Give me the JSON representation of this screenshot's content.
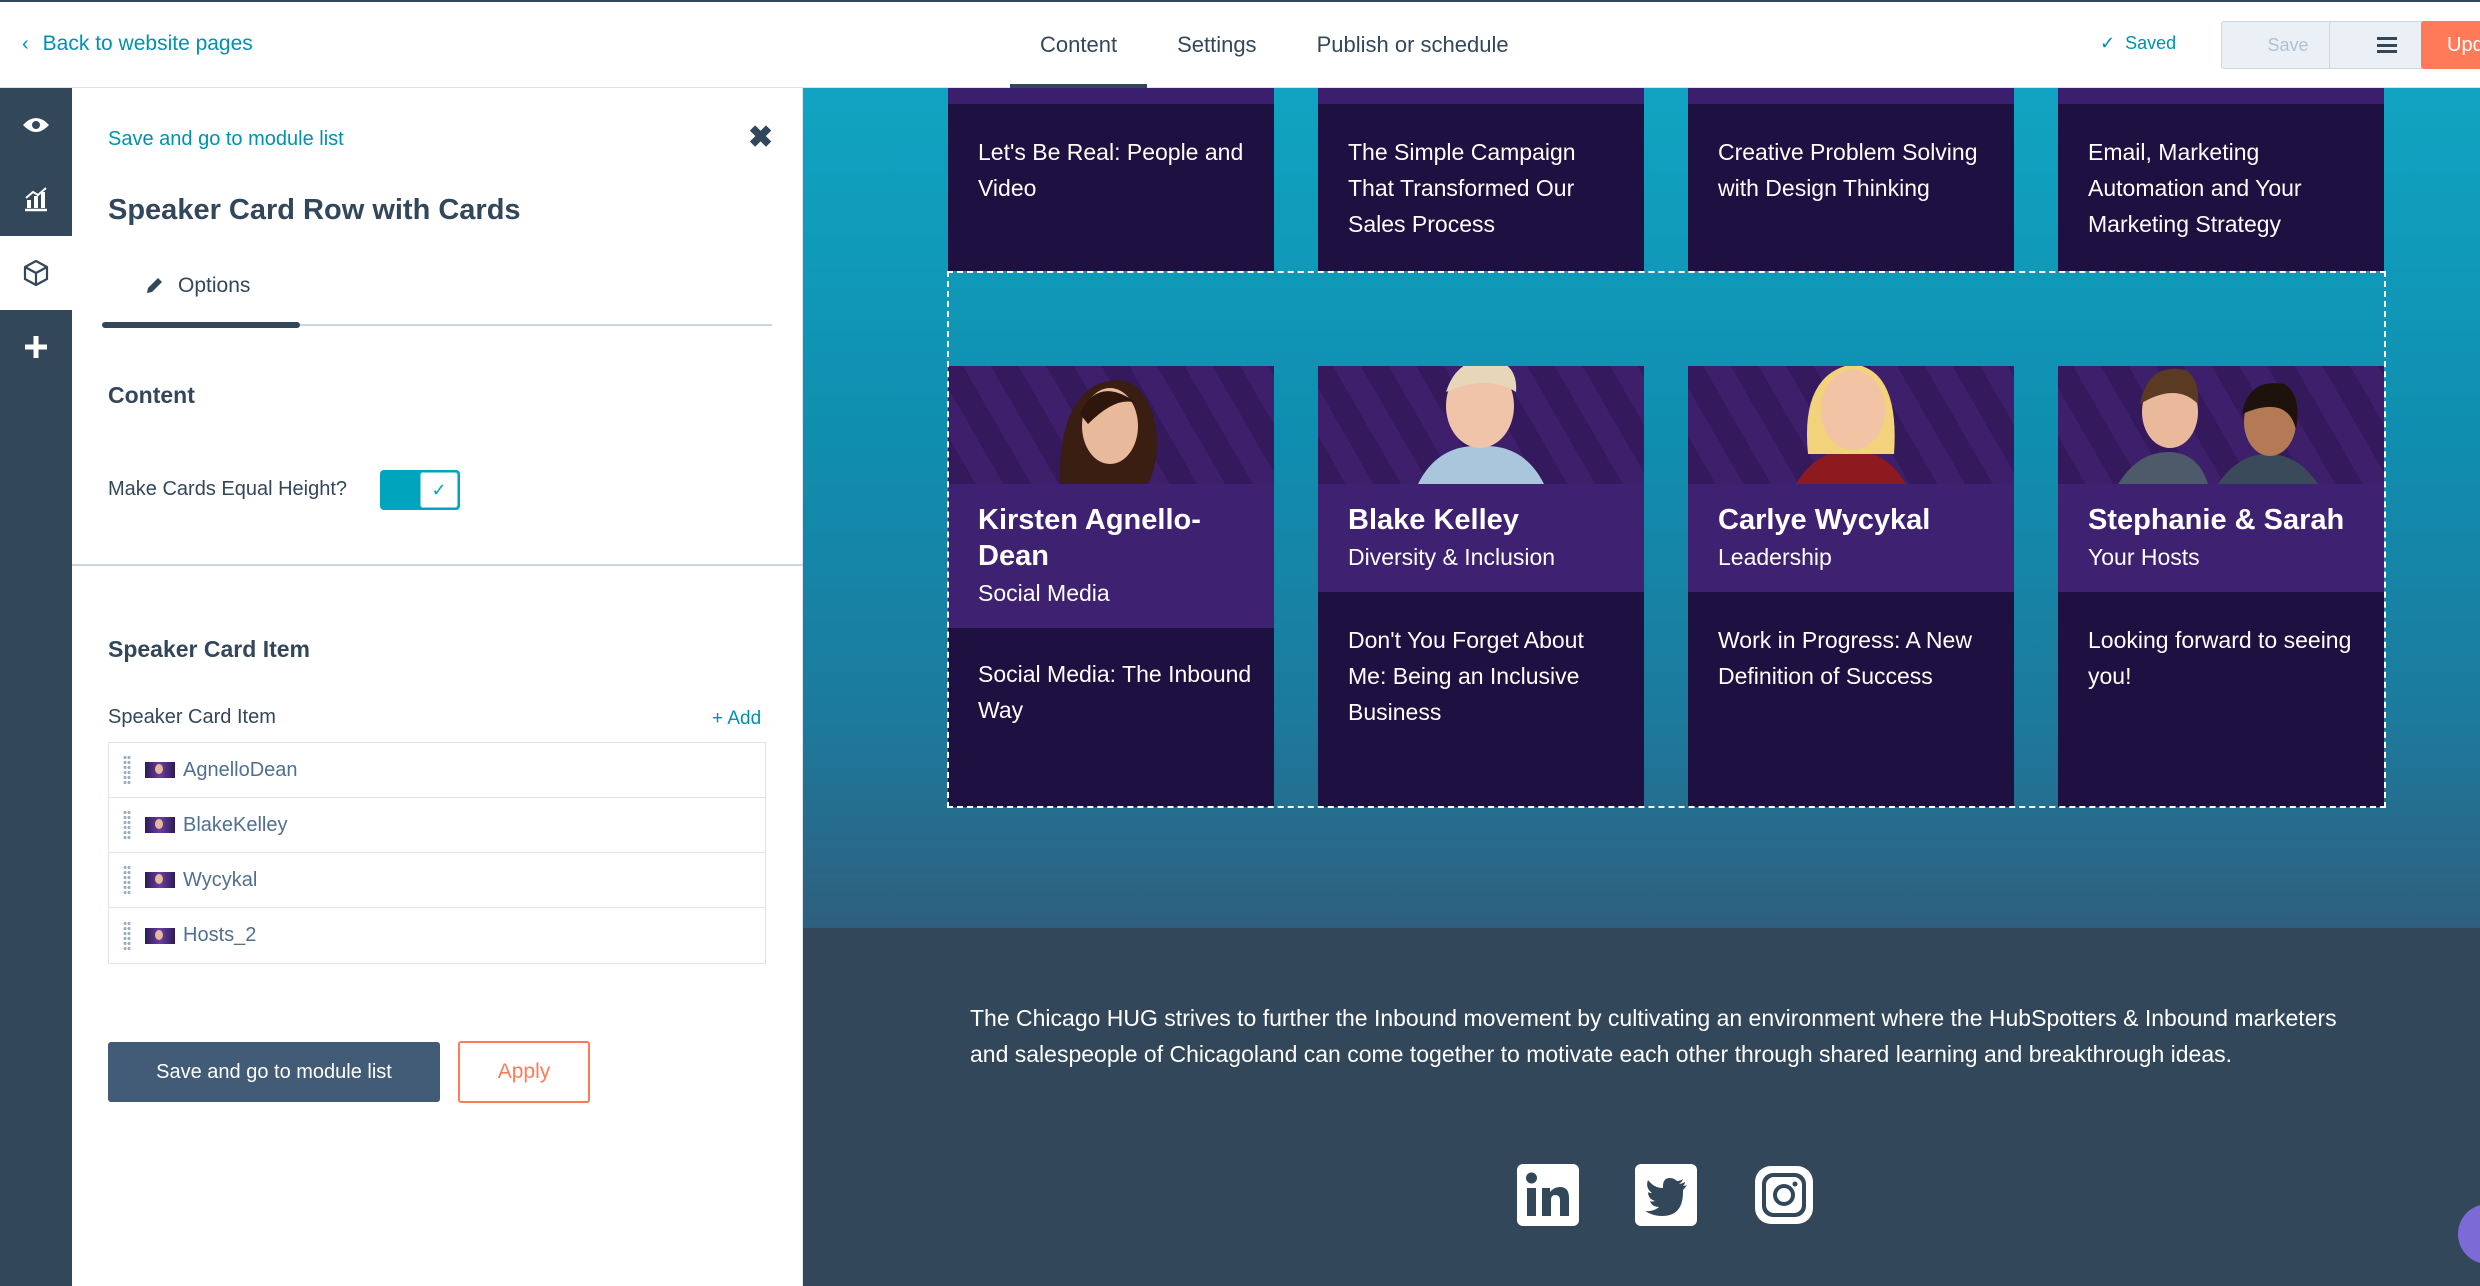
{
  "topbar": {
    "back_label": "Back to website pages",
    "tabs": [
      "Content",
      "Settings",
      "Publish or schedule"
    ],
    "active_tab": "Content",
    "saved_status": "Saved",
    "save_label": "Save",
    "update_label": "Upd"
  },
  "rail": {
    "icons": [
      "eye-icon",
      "chart-icon",
      "cube-icon",
      "plus-icon"
    ],
    "active": "cube-icon"
  },
  "sidebar": {
    "back_label": "Save and go to module list",
    "title": "Speaker Card Row with Cards",
    "tab_label": "Options",
    "content_heading": "Content",
    "equal_height_label": "Make Cards Equal Height?",
    "equal_height_on": true,
    "speaker_heading": "Speaker Card Item",
    "speaker_list_label": "Speaker Card Item",
    "add_label": "+ Add",
    "items": [
      "AgnelloDean",
      "BlakeKelley",
      "Wycykal",
      "Hosts_2"
    ],
    "primary_button": "Save and go to module list",
    "apply_button": "Apply"
  },
  "preview": {
    "top_cards": [
      "Let's Be Real: People and Video",
      "The Simple Campaign That Transformed Our Sales Process",
      "Creative Problem Solving with Design Thinking",
      "Email, Marketing Automation and Your Marketing Strategy"
    ],
    "speakers": [
      {
        "name": "Kirsten Agnello-Dean",
        "role": "Social Media",
        "talk": "Social Media: The Inbound Way"
      },
      {
        "name": "Blake Kelley",
        "role": "Diversity & Inclusion",
        "talk": "Don't You Forget About Me: Being an Inclusive Business"
      },
      {
        "name": "Carlye Wycykal",
        "role": "Leadership",
        "talk": "Work in Progress: A New Definition of Success"
      },
      {
        "name": "Stephanie & Sarah",
        "role": "Your Hosts",
        "talk": "Looking forward to seeing you!"
      }
    ],
    "footer_text": "The Chicago HUG strives to further the Inbound movement by cultivating an environment where the HubSpotters & Inbound marketers and salespeople of Chicagoland can come together to motivate each other through shared learning and breakthrough ideas.",
    "social_icons": [
      "linkedin-icon",
      "twitter-icon",
      "instagram-icon"
    ]
  },
  "colors": {
    "accent": "#0091ae",
    "rail": "#33475b",
    "card_dark": "#1e1040",
    "card_head": "#3e2170",
    "update_button": "#ff7a59",
    "hero_teal": "#11a4c2"
  }
}
